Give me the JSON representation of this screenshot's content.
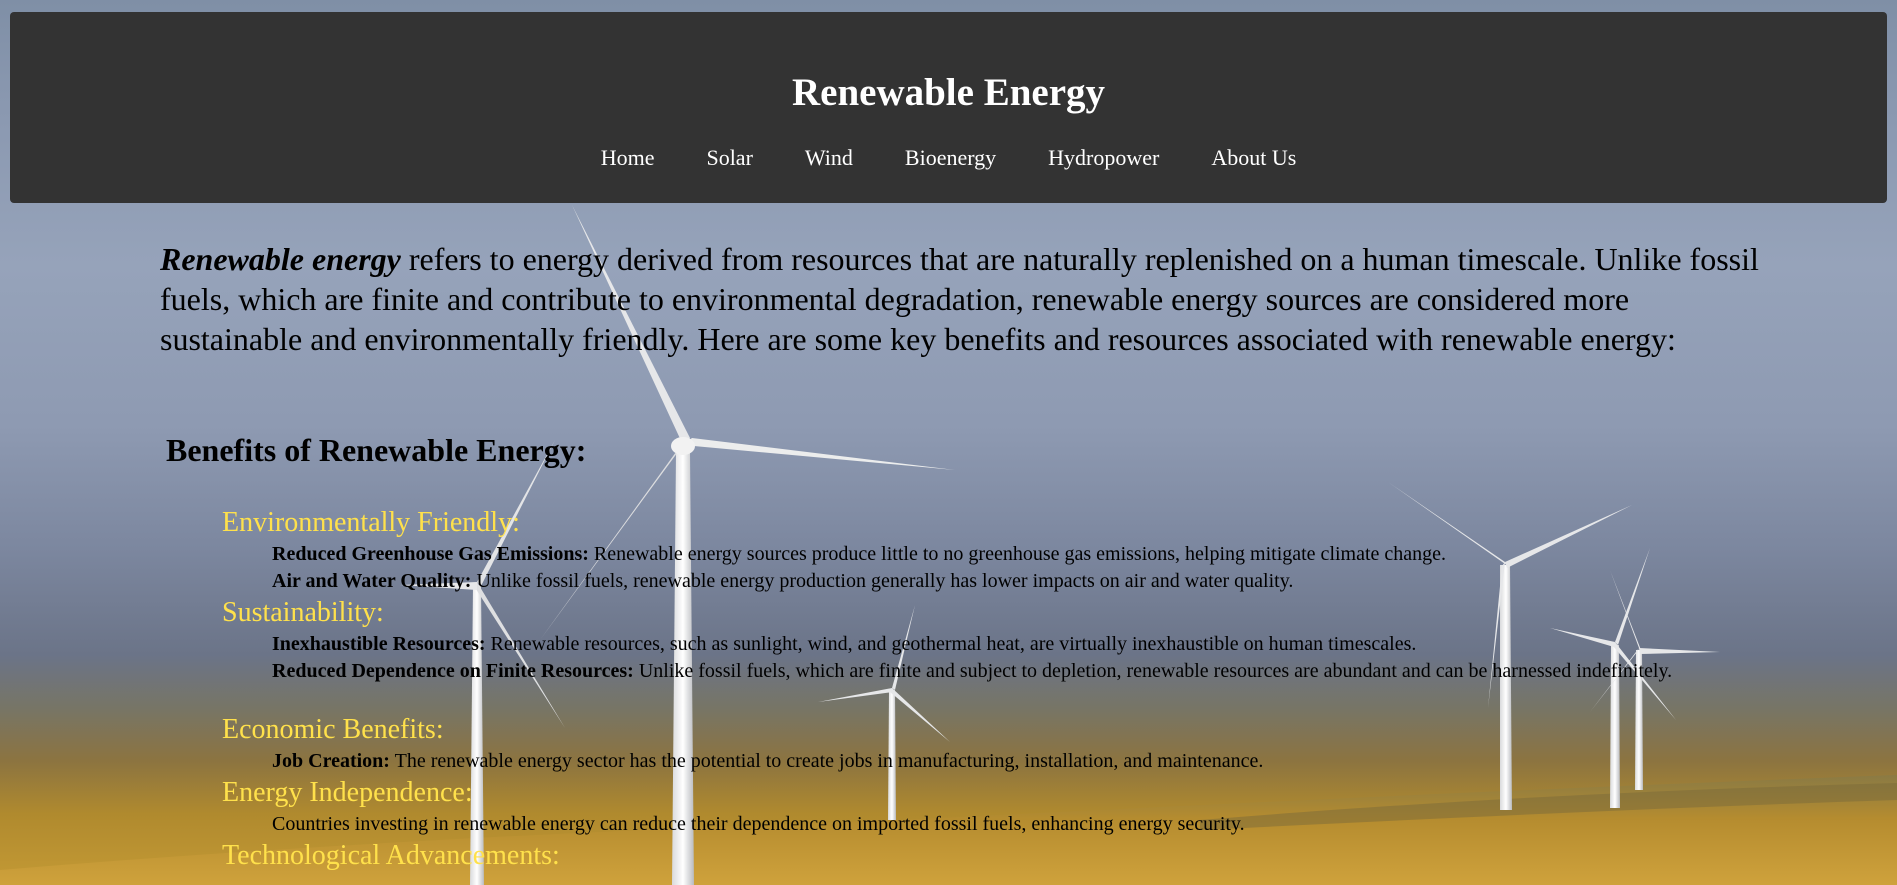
{
  "header": {
    "title": "Renewable Energy",
    "nav": [
      "Home",
      "Solar",
      "Wind",
      "Bioenergy",
      "Hydropower",
      "About Us"
    ]
  },
  "intro": {
    "lead": "Renewable energy",
    "rest": " refers to energy derived from resources that are naturally replenished on a human timescale. Unlike fossil fuels, which are finite and contribute to environmental degradation, renewable energy sources are considered more sustainable and environmentally friendly. Here are some key benefits and resources associated with renewable energy:"
  },
  "benefits": {
    "heading": "Benefits of Renewable Energy:",
    "categories": [
      {
        "title": "Environmentally Friendly:",
        "items": [
          {
            "term": "Reduced Greenhouse Gas Emissions:",
            "text": " Renewable energy sources produce little to no greenhouse gas emissions, helping mitigate climate change."
          },
          {
            "term": "Air and Water Quality:",
            "text": " Unlike fossil fuels, renewable energy production generally has lower impacts on air and water quality."
          }
        ]
      },
      {
        "title": "Sustainability:",
        "items": [
          {
            "term": "Inexhaustible Resources:",
            "text": " Renewable resources, such as sunlight, wind, and geothermal heat, are virtually inexhaustible on human timescales."
          },
          {
            "term": "Reduced Dependence on Finite Resources:",
            "text": " Unlike fossil fuels, which are finite and subject to depletion, renewable resources are abundant and can be harnessed indefinitely."
          }
        ]
      },
      {
        "title": "Economic Benefits:",
        "items": [
          {
            "term": "Job Creation:",
            "text": " The renewable energy sector has the potential to create jobs in manufacturing, installation, and maintenance."
          }
        ]
      },
      {
        "title": "Energy Independence:",
        "items": [
          {
            "term": "",
            "text": "Countries investing in renewable energy can reduce their dependence on imported fossil fuels, enhancing energy security."
          }
        ]
      },
      {
        "title": "Technological Advancements:",
        "items": []
      }
    ]
  },
  "colors": {
    "header_bg": "#333333",
    "category_text": "#ffe14b",
    "nav_text": "#ffffff"
  }
}
